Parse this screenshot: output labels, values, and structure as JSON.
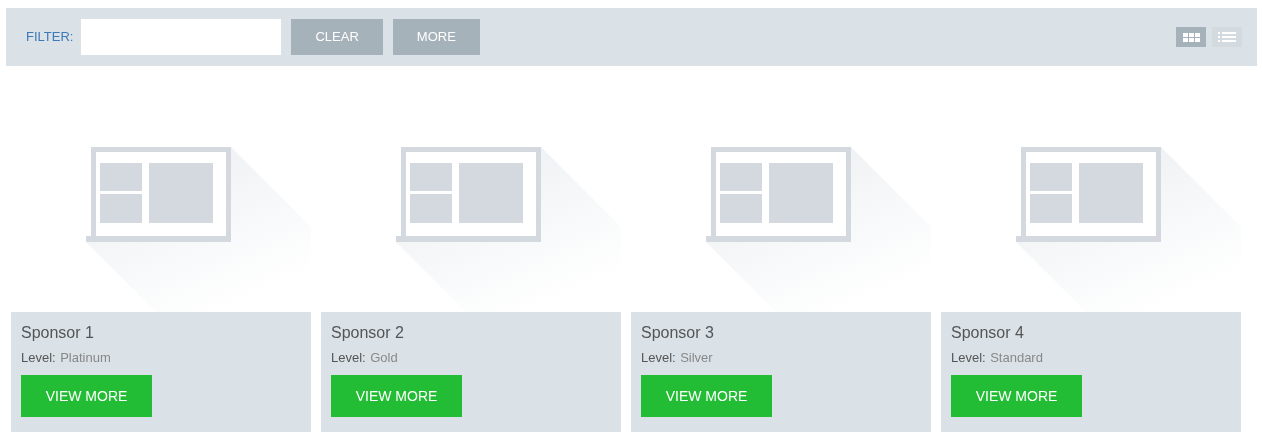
{
  "toolbar": {
    "filter_label": "FILTER:",
    "buttons": [
      "CLEAR",
      "MORE"
    ],
    "views": [
      {
        "kind": "grid",
        "selected": true
      },
      {
        "kind": "list",
        "selected": false
      }
    ]
  },
  "sponsors": [
    {
      "name": "Sponsor 1",
      "level_label": "Level:",
      "level": "Platinum",
      "button": "VIEW MORE"
    },
    {
      "name": "Sponsor 2",
      "level_label": "Level:",
      "level": "Gold",
      "button": "VIEW MORE"
    },
    {
      "name": "Sponsor 3",
      "level_label": "Level:",
      "level": "Silver",
      "button": "VIEW MORE"
    },
    {
      "name": "Sponsor 4",
      "level_label": "Level:",
      "level": "Standard",
      "button": "VIEW MORE"
    }
  ]
}
